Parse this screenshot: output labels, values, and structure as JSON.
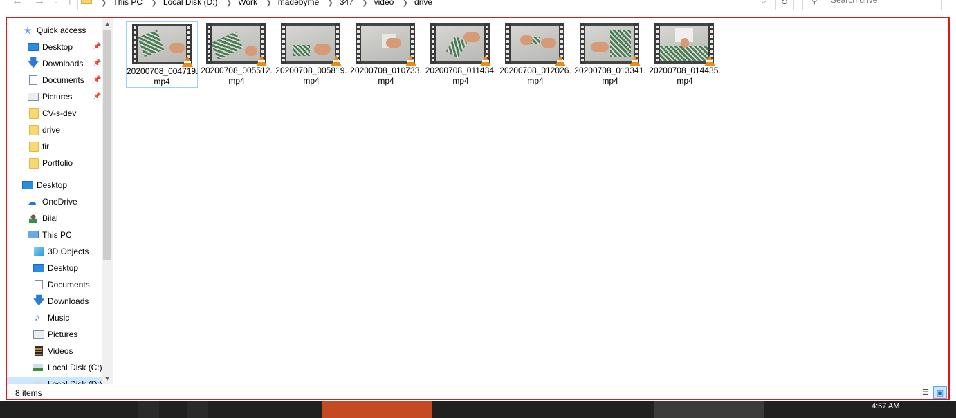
{
  "address_bar": {
    "crumbs": [
      "This PC",
      "Local Disk (D:)",
      "Work",
      "madebyme",
      "347",
      "video",
      "drive"
    ],
    "search_placeholder": "Search drive"
  },
  "nav_pane": {
    "quick_access": {
      "label": "Quick access",
      "items": [
        {
          "label": "Desktop",
          "icon": "desktop-icon",
          "pinned": true
        },
        {
          "label": "Downloads",
          "icon": "downloads-icon",
          "pinned": true
        },
        {
          "label": "Documents",
          "icon": "documents-icon",
          "pinned": true
        },
        {
          "label": "Pictures",
          "icon": "pictures-icon",
          "pinned": true
        },
        {
          "label": "CV-s-dev",
          "icon": "folder-icon",
          "pinned": false
        },
        {
          "label": "drive",
          "icon": "folder-icon",
          "pinned": false
        },
        {
          "label": "fir",
          "icon": "folder-icon",
          "pinned": false
        },
        {
          "label": "Portfolio",
          "icon": "folder-icon",
          "pinned": false
        }
      ]
    },
    "roots": [
      {
        "label": "Desktop",
        "icon": "desktop-icon"
      },
      {
        "label": "OneDrive",
        "icon": "onedrive-icon"
      },
      {
        "label": "Bilal",
        "icon": "user-icon"
      },
      {
        "label": "This PC",
        "icon": "this-pc-icon"
      }
    ],
    "this_pc_items": [
      {
        "label": "3D Objects",
        "icon": "3d-objects-icon"
      },
      {
        "label": "Desktop",
        "icon": "desktop-icon"
      },
      {
        "label": "Documents",
        "icon": "documents-icon"
      },
      {
        "label": "Downloads",
        "icon": "downloads-icon"
      },
      {
        "label": "Music",
        "icon": "music-icon"
      },
      {
        "label": "Pictures",
        "icon": "pictures-icon"
      },
      {
        "label": "Videos",
        "icon": "videos-icon"
      },
      {
        "label": "Local Disk (C:)",
        "icon": "local-disk-icon"
      },
      {
        "label": "Local Disk (D:)",
        "icon": "local-disk-icon",
        "selected": true
      }
    ]
  },
  "files": [
    {
      "name_line1": "20200708_004719.",
      "name_line2": "mp4",
      "selected": true
    },
    {
      "name_line1": "20200708_005512.",
      "name_line2": "mp4"
    },
    {
      "name_line1": "20200708_005819.",
      "name_line2": "mp4"
    },
    {
      "name_line1": "20200708_010733.",
      "name_line2": "mp4"
    },
    {
      "name_line1": "20200708_011434.",
      "name_line2": "mp4"
    },
    {
      "name_line1": "20200708_012026.",
      "name_line2": "mp4"
    },
    {
      "name_line1": "20200708_013341.",
      "name_line2": "mp4"
    },
    {
      "name_line1": "20200708_014435.",
      "name_line2": "mp4"
    }
  ],
  "status_bar": {
    "item_count": "8 items"
  },
  "taskbar": {
    "clock": "4:57 AM"
  },
  "colors": {
    "highlight_frame": "#e0161b",
    "selection": "#cce8ff",
    "selection_border": "#99d1ff",
    "vlc_cone": "#f08a16"
  }
}
